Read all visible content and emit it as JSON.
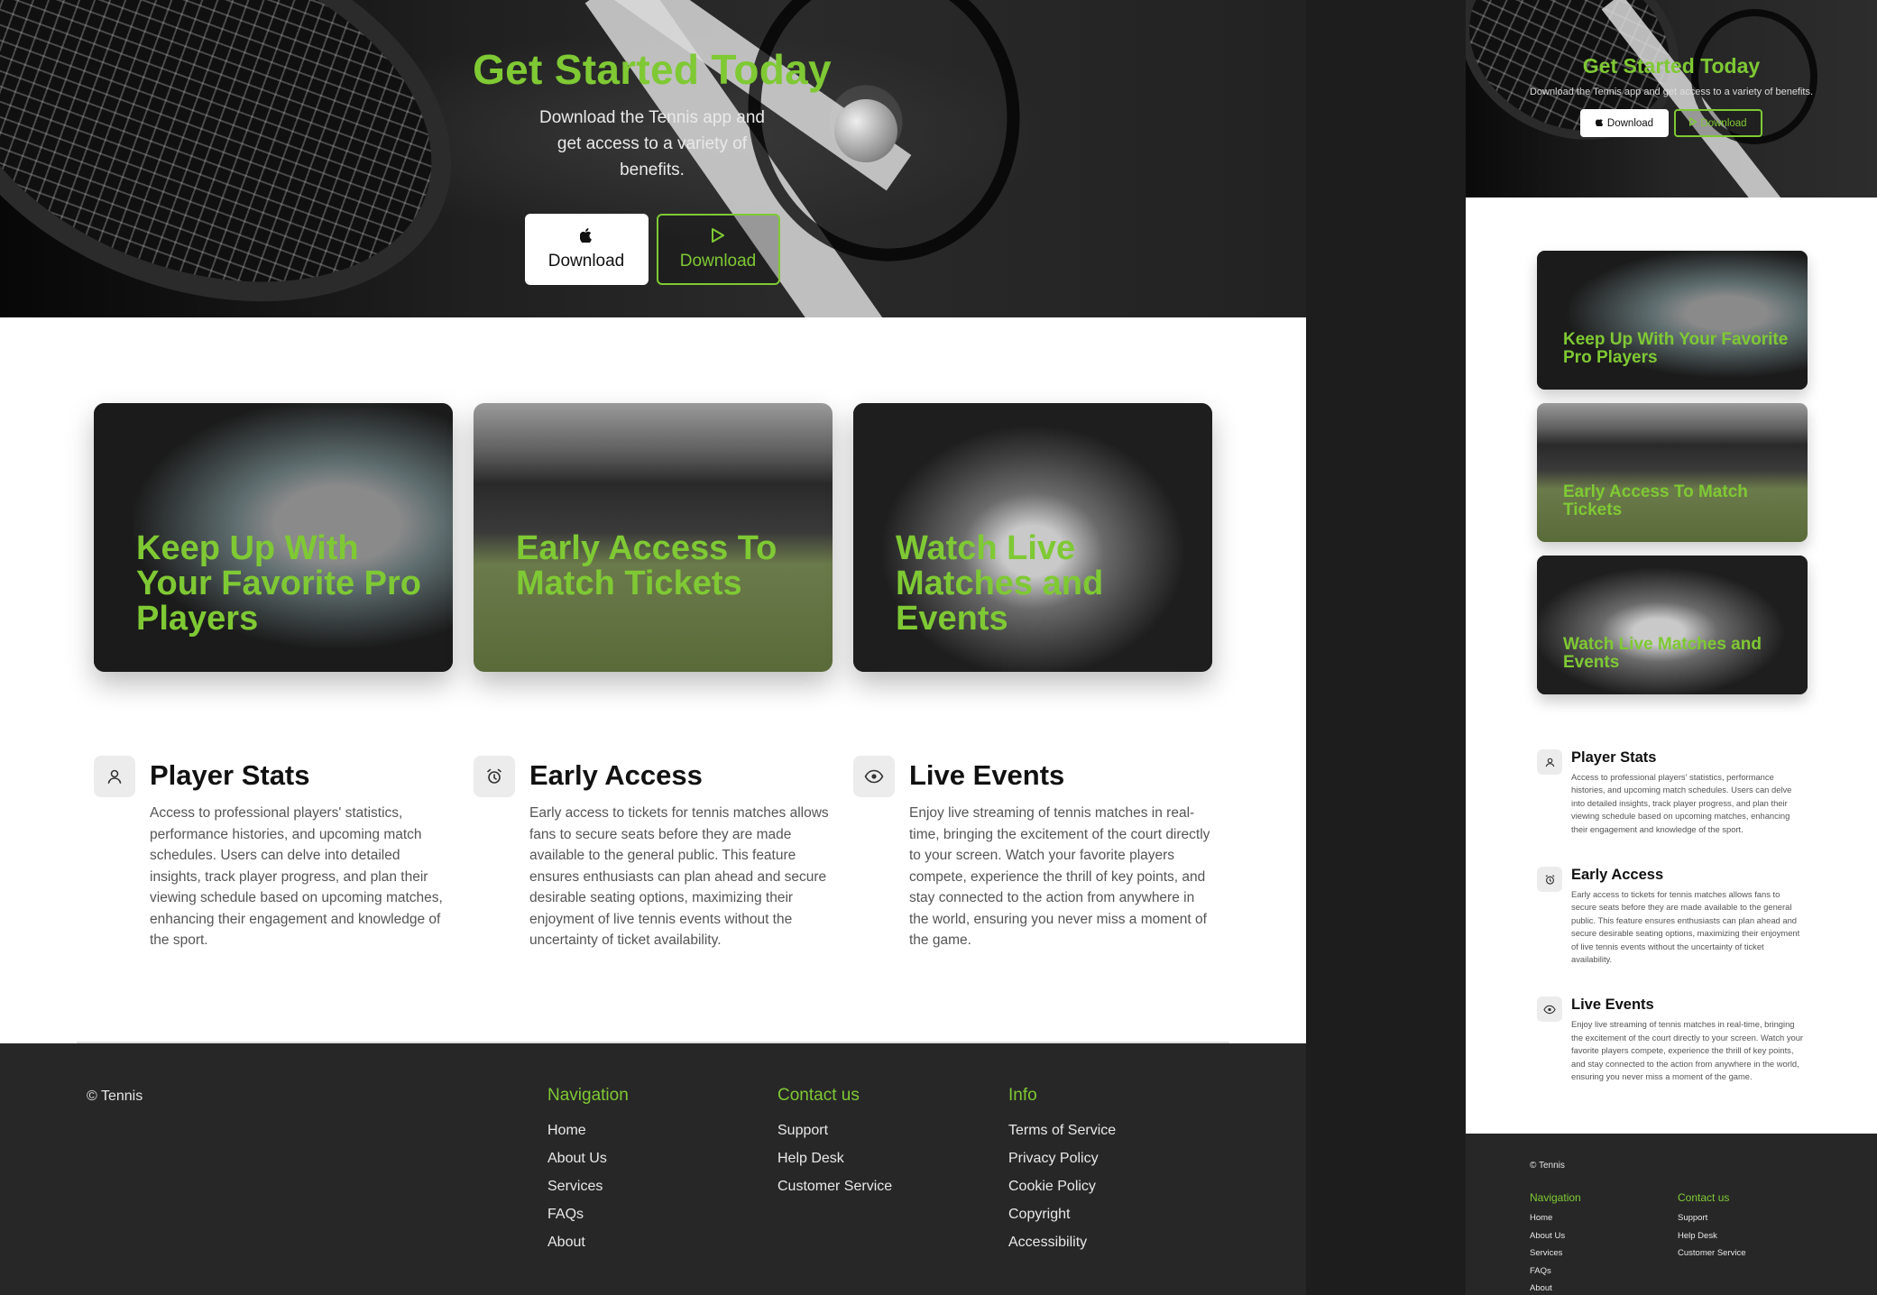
{
  "hero": {
    "title": "Get Started Today",
    "subtitle": "Download the Tennis app and get access to a variety of benefits.",
    "buttons": [
      {
        "label": "Download",
        "icon": "apple-icon"
      },
      {
        "label": "Download",
        "icon": "play-store-icon"
      }
    ]
  },
  "cards": [
    {
      "label": "Keep Up With Your Favorite Pro Players",
      "image": "tennis-player-fist-pump-image"
    },
    {
      "label": "Early Access To Match Tickets",
      "image": "tennis-stadium-crowd-image"
    },
    {
      "label": "Watch Live Matches and Events",
      "image": "tennis-player-forehand-image"
    }
  ],
  "features": [
    {
      "title": "Player Stats",
      "icon": "user-icon",
      "text": "Access to professional players' statistics, performance histories, and upcoming match schedules. Users can delve into detailed insights, track player progress, and plan their viewing schedule based on upcoming matches, enhancing their engagement and knowledge of the sport."
    },
    {
      "title": "Early Access",
      "icon": "alarm-clock-icon",
      "text": "Early access to tickets for tennis matches allows fans to secure seats before they are made available to the general public. This feature ensures enthusiasts can plan ahead and secure desirable seating options, maximizing their enjoyment of live tennis events without the uncertainty of ticket availability."
    },
    {
      "title": "Live Events",
      "icon": "eye-icon",
      "text": "Enjoy live streaming of tennis matches in real-time, bringing the excitement of the court directly to your screen. Watch your favorite players compete, experience the thrill of key points, and stay connected to the action from anywhere in the world, ensuring you never miss a moment of the game."
    }
  ],
  "footer": {
    "copyright": "© Tennis",
    "columns": [
      {
        "heading": "Navigation",
        "links": [
          "Home",
          "About Us",
          "Services",
          "FAQs",
          "About"
        ]
      },
      {
        "heading": "Contact us",
        "links": [
          "Support",
          "Help Desk",
          "Customer Service"
        ]
      },
      {
        "heading": "Info",
        "links": [
          "Terms of Service",
          "Privacy Policy",
          "Cookie Policy",
          "Copyright",
          "Accessibility"
        ]
      }
    ]
  },
  "mobile": {
    "subtitle": "Download the Tennis app and get access to a variety of benefits."
  },
  "colors": {
    "accent": "#7fc934",
    "footer_bg": "#272727",
    "hero_bg": "#1f1f1f"
  }
}
